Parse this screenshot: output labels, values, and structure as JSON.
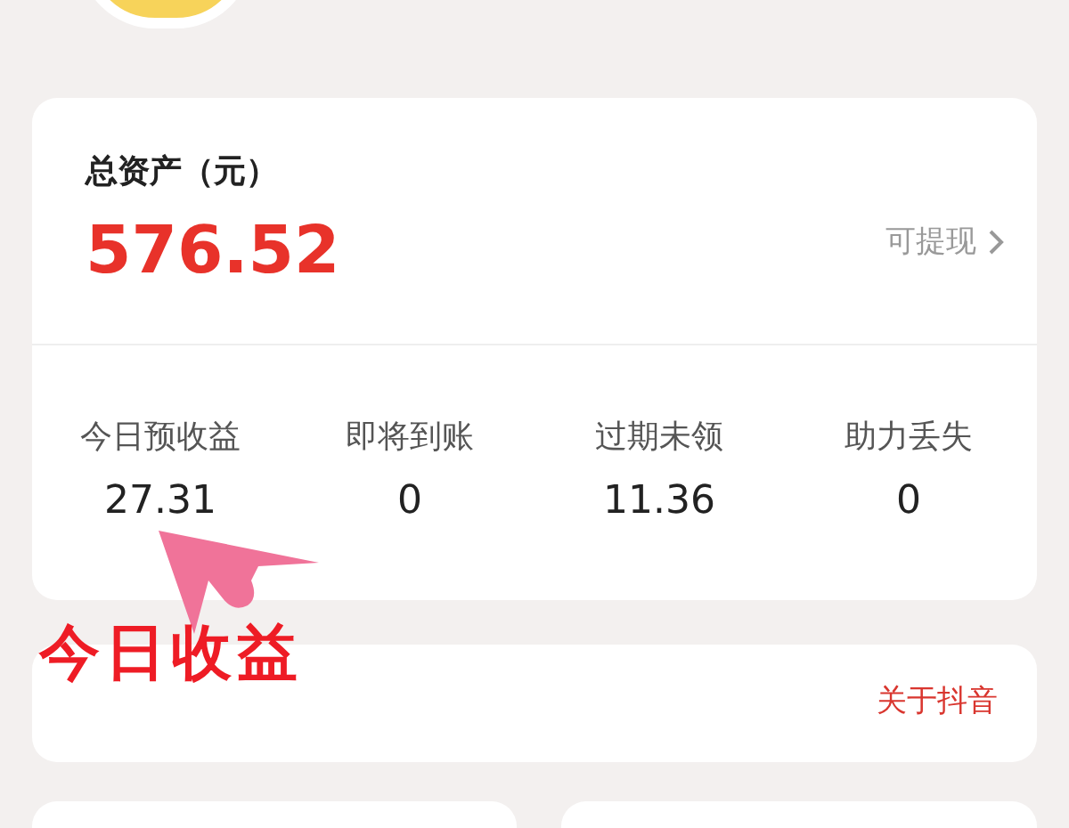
{
  "assets": {
    "title": "总资产（元）",
    "amount": "576.52",
    "withdraw": "可提现"
  },
  "stats": [
    {
      "label": "今日预收益",
      "value": "27.31"
    },
    {
      "label": "即将到账",
      "value": "0"
    },
    {
      "label": "过期未领",
      "value": "11.36"
    },
    {
      "label": "助力丢失",
      "value": "0"
    }
  ],
  "link_card": {
    "link": "关于抖音"
  },
  "annotation": {
    "text": "今日收益"
  }
}
